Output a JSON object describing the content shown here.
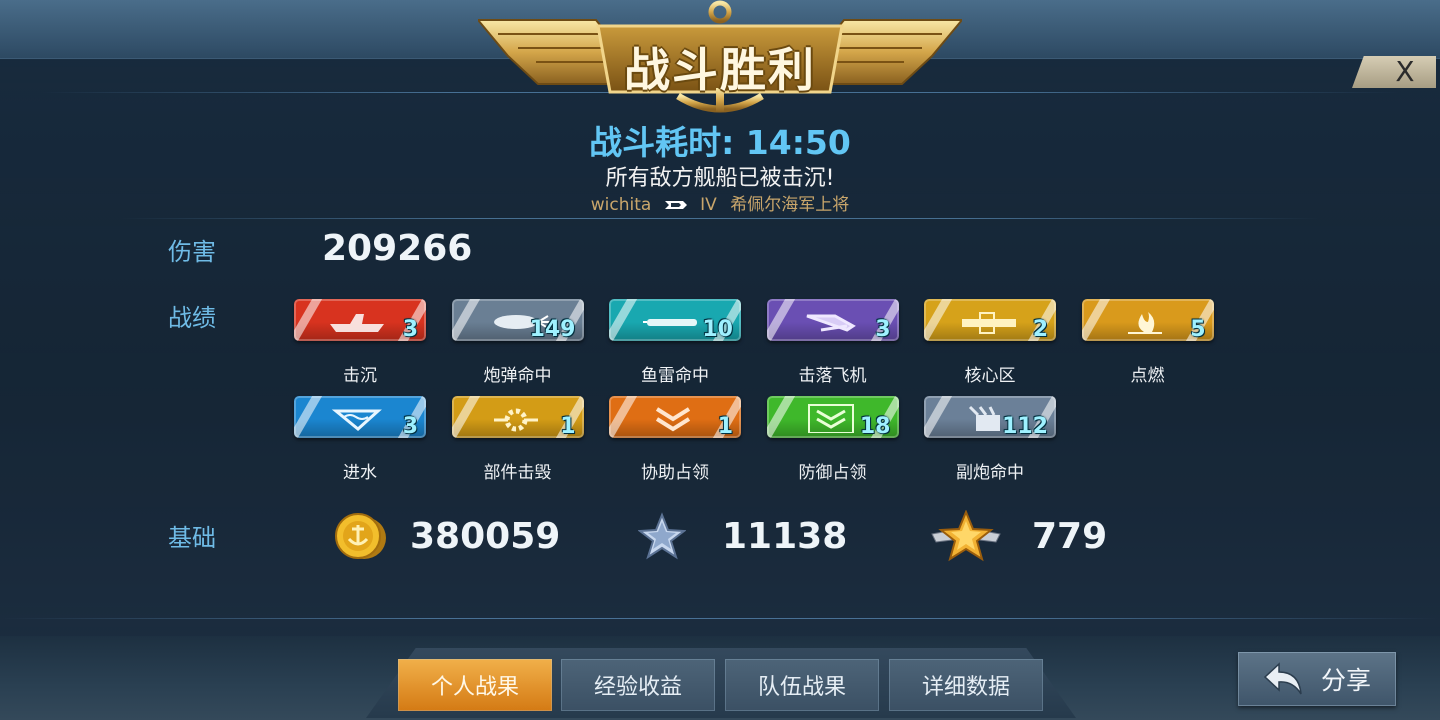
{
  "header": {
    "title": "战斗胜利",
    "close_label": "X"
  },
  "summary": {
    "battle_time": "战斗耗时: 14:50",
    "message": "所有敌方舰船已被击沉!",
    "player_name": "wichita",
    "tier": "IV",
    "captain": "希佩尔海军上将"
  },
  "damage": {
    "label": "伤害",
    "value": "209266"
  },
  "record": {
    "label": "战绩",
    "medals": [
      {
        "label": "击沉",
        "count": "3",
        "color": "#d8331f",
        "icon": "sink-ship-icon"
      },
      {
        "label": "炮弹命中",
        "count": "149",
        "color": "#6a7f94",
        "icon": "shell-hit-icon"
      },
      {
        "label": "鱼雷命中",
        "count": "10",
        "color": "#19a8b0",
        "icon": "torpedo-hit-icon"
      },
      {
        "label": "击落飞机",
        "count": "3",
        "color": "#6a4fb3",
        "icon": "plane-shootdown-icon"
      },
      {
        "label": "核心区",
        "count": "2",
        "color": "#d6a21a",
        "icon": "citadel-icon"
      },
      {
        "label": "点燃",
        "count": "5",
        "color": "#d99a1c",
        "icon": "fire-icon"
      },
      {
        "label": "进水",
        "count": "3",
        "color": "#1b86d0",
        "icon": "flooding-icon"
      },
      {
        "label": "部件击毁",
        "count": "1",
        "color": "#d39c16",
        "icon": "module-destroy-icon"
      },
      {
        "label": "协助占领",
        "count": "1",
        "color": "#df6e14",
        "icon": "capture-assist-icon"
      },
      {
        "label": "防御占领",
        "count": "18",
        "color": "#3fb82b",
        "icon": "capture-defend-icon"
      },
      {
        "label": "副炮命中",
        "count": "112",
        "color": "#6b8098",
        "icon": "secondary-hit-icon"
      }
    ]
  },
  "base": {
    "label": "基础",
    "credits": "380059",
    "experience": "11138",
    "commander_xp": "779"
  },
  "tabs": [
    "个人战果",
    "经验收益",
    "队伍战果",
    "详细数据"
  ],
  "active_tab": "个人战果",
  "share_label": "分享"
}
